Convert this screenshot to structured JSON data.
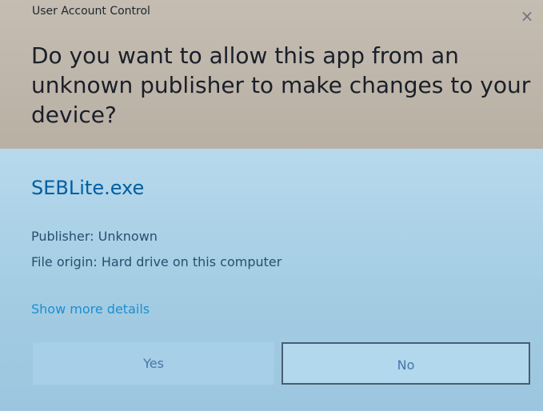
{
  "dialog": {
    "title": "User Account Control",
    "close_glyph": "×",
    "question": "Do you want to allow this app from an unknown publisher to make changes to your device?"
  },
  "app": {
    "name": "SEBLite.exe",
    "publisher": "Publisher: Unknown",
    "origin": "File origin: Hard drive on this computer"
  },
  "details_link": "Show more details",
  "buttons": {
    "yes_label": "Yes",
    "no_label": "No"
  },
  "colors": {
    "header_bg": "#c5bdb2",
    "body_bg": "#a3cce3",
    "accent": "#005ea0",
    "link": "#1b8fd0"
  },
  "icons": {
    "close": "close-icon"
  }
}
